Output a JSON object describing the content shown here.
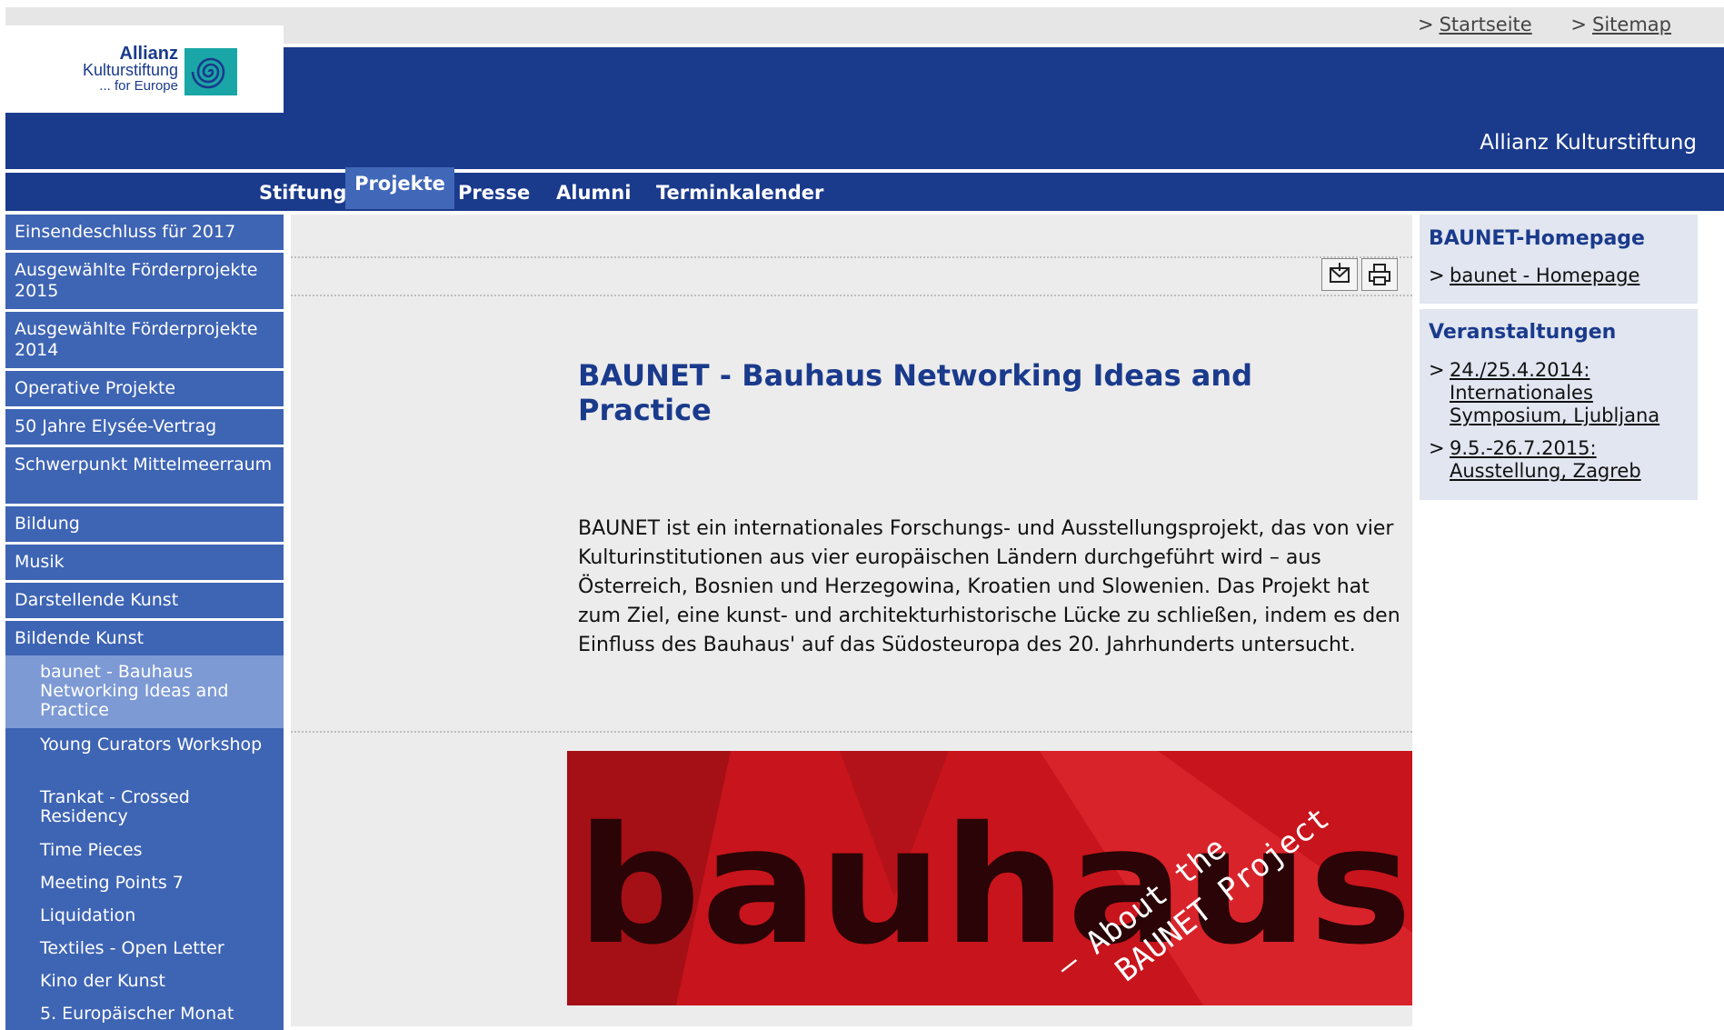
{
  "top_links": [
    {
      "label": "Startseite"
    },
    {
      "label": "Sitemap"
    }
  ],
  "logo": {
    "line1": "Allianz",
    "line2": "Kulturstiftung",
    "line3": "... for Europe"
  },
  "site_name": "Allianz Kulturstiftung",
  "main_nav": [
    {
      "label": "Stiftung",
      "active": false
    },
    {
      "label": "Projekte",
      "active": true
    },
    {
      "label": "Presse",
      "active": false
    },
    {
      "label": "Alumni",
      "active": false
    },
    {
      "label": "Terminkalender",
      "active": false
    }
  ],
  "sidebar": {
    "items": [
      {
        "label": "Einsendeschluss für 2017"
      },
      {
        "label": "Ausgewählte Förderprojekte 2015"
      },
      {
        "label": "Ausgewählte Förderprojekte 2014"
      },
      {
        "label": "Operative Projekte"
      },
      {
        "label": "50 Jahre Elysée-Vertrag"
      },
      {
        "label": "Schwerpunkt Mittelmeerraum"
      },
      {
        "label": "Bildung"
      },
      {
        "label": "Musik"
      },
      {
        "label": "Darstellende Kunst"
      },
      {
        "label": "Bildende Kunst"
      }
    ],
    "subitems": [
      {
        "label": "baunet - Bauhaus Networking Ideas and Practice",
        "active": true
      },
      {
        "label": "Young Curators Workshop",
        "active": false
      },
      {
        "label": "Trankat - Crossed Residency",
        "active": false
      },
      {
        "label": "Time Pieces",
        "active": false
      },
      {
        "label": "Meeting Points 7",
        "active": false
      },
      {
        "label": "Liquidation",
        "active": false
      },
      {
        "label": "Textiles - Open Letter",
        "active": false
      },
      {
        "label": "Kino der Kunst",
        "active": false
      },
      {
        "label": "5. Europäischer Monat",
        "active": false
      }
    ]
  },
  "content": {
    "title": "BAUNET - Bauhaus Networking Ideas and Practice",
    "intro": "BAUNET ist ein internationales Forschungs- und Ausstellungsprojekt, das von vier Kulturinstitutionen aus vier europäischen Ländern durchgeführt wird – aus Österreich, Bosnien und Herzegowina, Kroatien und Slowenien. Das Projekt hat zum Ziel, eine kunst- und architekturhistorische Lücke zu schließen, indem es den Einfluss des Bauhaus' auf das Südosteuropa des 20. Jahrhunderts untersucht.",
    "hero_word": "bauhaus",
    "hero_overlay_line1": "– About the",
    "hero_overlay_line2": "BAUNET Project",
    "hero_color": "#c8141c"
  },
  "right": {
    "homepage_title": "BAUNET-Homepage",
    "homepage_link": "baunet - Homepage",
    "events_title": "Veranstaltungen",
    "events": [
      {
        "label": "24./25.4.2014: Internationales Symposium, Ljubljana"
      },
      {
        "label": "9.5.-26.7.2015: Ausstellung, Zagreb"
      }
    ]
  },
  "colors": {
    "brand_blue": "#1a3a8c",
    "sidebar_blue": "#3e64b4",
    "sidebar_active": "#7d9ad5",
    "logo_teal": "#1aa6a6"
  }
}
